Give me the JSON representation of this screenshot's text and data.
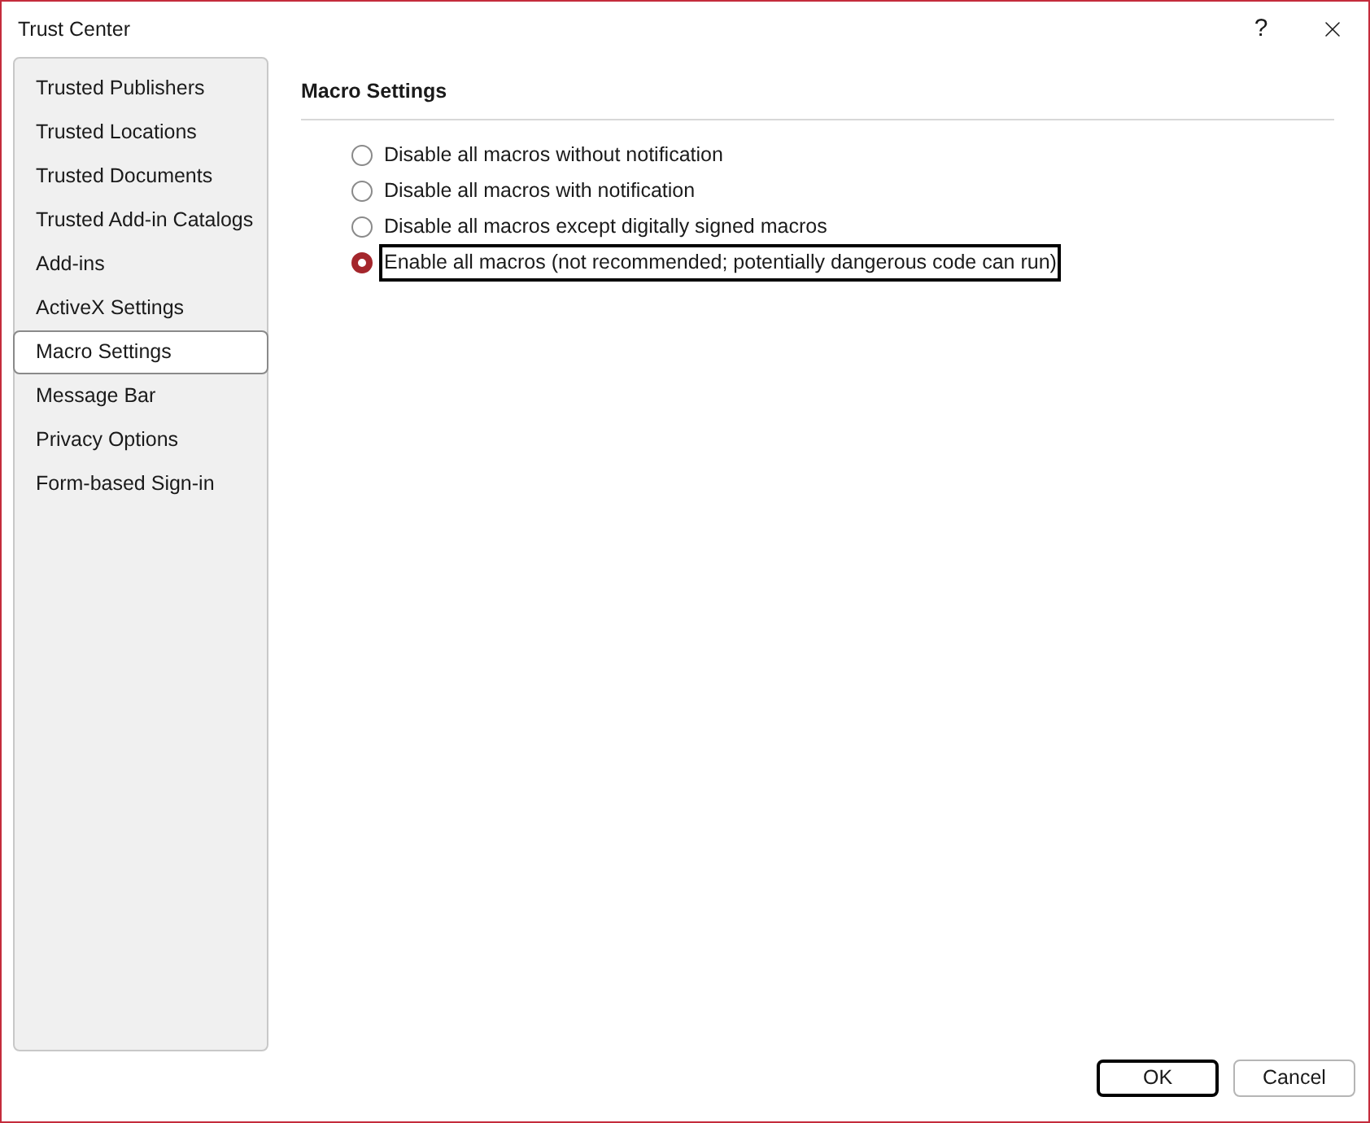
{
  "window": {
    "title": "Trust Center",
    "help": "?"
  },
  "sidebar": {
    "items": [
      {
        "label": "Trusted Publishers",
        "selected": false
      },
      {
        "label": "Trusted Locations",
        "selected": false
      },
      {
        "label": "Trusted Documents",
        "selected": false
      },
      {
        "label": "Trusted Add-in Catalogs",
        "selected": false
      },
      {
        "label": "Add-ins",
        "selected": false
      },
      {
        "label": "ActiveX Settings",
        "selected": false
      },
      {
        "label": "Macro Settings",
        "selected": true
      },
      {
        "label": "Message Bar",
        "selected": false
      },
      {
        "label": "Privacy Options",
        "selected": false
      },
      {
        "label": "Form-based Sign-in",
        "selected": false
      }
    ]
  },
  "section": {
    "title": "Macro Settings",
    "options": [
      {
        "label": "Disable all macros without notification",
        "selected": false
      },
      {
        "label": "Disable all macros with notification",
        "selected": false
      },
      {
        "label": "Disable all macros except digitally signed macros",
        "selected": false
      },
      {
        "label": "Enable all macros (not recommended; potentially dangerous code can run)",
        "selected": true
      }
    ]
  },
  "buttons": [
    {
      "label": "OK",
      "default": true
    },
    {
      "label": "Cancel",
      "default": false
    }
  ]
}
